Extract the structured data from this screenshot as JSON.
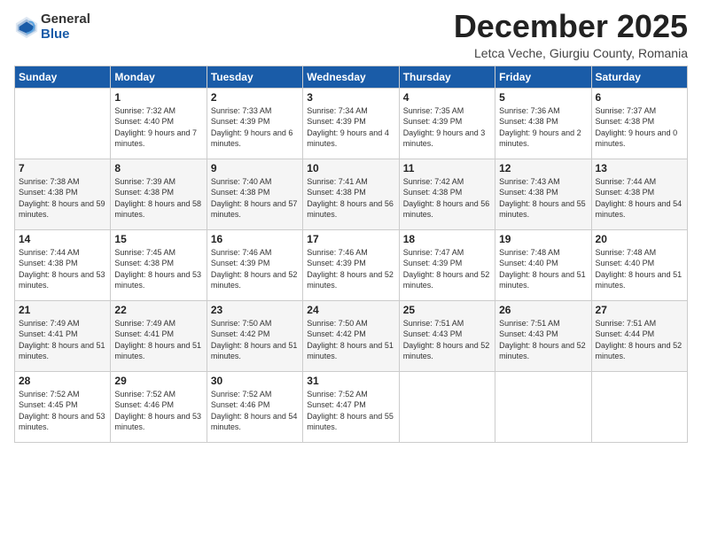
{
  "header": {
    "logo_line1": "General",
    "logo_line2": "Blue",
    "title": "December 2025",
    "location": "Letca Veche, Giurgiu County, Romania"
  },
  "days_of_week": [
    "Sunday",
    "Monday",
    "Tuesday",
    "Wednesday",
    "Thursday",
    "Friday",
    "Saturday"
  ],
  "weeks": [
    [
      {
        "day": "",
        "sunrise": "",
        "sunset": "",
        "daylight": ""
      },
      {
        "day": "1",
        "sunrise": "Sunrise: 7:32 AM",
        "sunset": "Sunset: 4:40 PM",
        "daylight": "Daylight: 9 hours and 7 minutes."
      },
      {
        "day": "2",
        "sunrise": "Sunrise: 7:33 AM",
        "sunset": "Sunset: 4:39 PM",
        "daylight": "Daylight: 9 hours and 6 minutes."
      },
      {
        "day": "3",
        "sunrise": "Sunrise: 7:34 AM",
        "sunset": "Sunset: 4:39 PM",
        "daylight": "Daylight: 9 hours and 4 minutes."
      },
      {
        "day": "4",
        "sunrise": "Sunrise: 7:35 AM",
        "sunset": "Sunset: 4:39 PM",
        "daylight": "Daylight: 9 hours and 3 minutes."
      },
      {
        "day": "5",
        "sunrise": "Sunrise: 7:36 AM",
        "sunset": "Sunset: 4:38 PM",
        "daylight": "Daylight: 9 hours and 2 minutes."
      },
      {
        "day": "6",
        "sunrise": "Sunrise: 7:37 AM",
        "sunset": "Sunset: 4:38 PM",
        "daylight": "Daylight: 9 hours and 0 minutes."
      }
    ],
    [
      {
        "day": "7",
        "sunrise": "Sunrise: 7:38 AM",
        "sunset": "Sunset: 4:38 PM",
        "daylight": "Daylight: 8 hours and 59 minutes."
      },
      {
        "day": "8",
        "sunrise": "Sunrise: 7:39 AM",
        "sunset": "Sunset: 4:38 PM",
        "daylight": "Daylight: 8 hours and 58 minutes."
      },
      {
        "day": "9",
        "sunrise": "Sunrise: 7:40 AM",
        "sunset": "Sunset: 4:38 PM",
        "daylight": "Daylight: 8 hours and 57 minutes."
      },
      {
        "day": "10",
        "sunrise": "Sunrise: 7:41 AM",
        "sunset": "Sunset: 4:38 PM",
        "daylight": "Daylight: 8 hours and 56 minutes."
      },
      {
        "day": "11",
        "sunrise": "Sunrise: 7:42 AM",
        "sunset": "Sunset: 4:38 PM",
        "daylight": "Daylight: 8 hours and 56 minutes."
      },
      {
        "day": "12",
        "sunrise": "Sunrise: 7:43 AM",
        "sunset": "Sunset: 4:38 PM",
        "daylight": "Daylight: 8 hours and 55 minutes."
      },
      {
        "day": "13",
        "sunrise": "Sunrise: 7:44 AM",
        "sunset": "Sunset: 4:38 PM",
        "daylight": "Daylight: 8 hours and 54 minutes."
      }
    ],
    [
      {
        "day": "14",
        "sunrise": "Sunrise: 7:44 AM",
        "sunset": "Sunset: 4:38 PM",
        "daylight": "Daylight: 8 hours and 53 minutes."
      },
      {
        "day": "15",
        "sunrise": "Sunrise: 7:45 AM",
        "sunset": "Sunset: 4:38 PM",
        "daylight": "Daylight: 8 hours and 53 minutes."
      },
      {
        "day": "16",
        "sunrise": "Sunrise: 7:46 AM",
        "sunset": "Sunset: 4:39 PM",
        "daylight": "Daylight: 8 hours and 52 minutes."
      },
      {
        "day": "17",
        "sunrise": "Sunrise: 7:46 AM",
        "sunset": "Sunset: 4:39 PM",
        "daylight": "Daylight: 8 hours and 52 minutes."
      },
      {
        "day": "18",
        "sunrise": "Sunrise: 7:47 AM",
        "sunset": "Sunset: 4:39 PM",
        "daylight": "Daylight: 8 hours and 52 minutes."
      },
      {
        "day": "19",
        "sunrise": "Sunrise: 7:48 AM",
        "sunset": "Sunset: 4:40 PM",
        "daylight": "Daylight: 8 hours and 51 minutes."
      },
      {
        "day": "20",
        "sunrise": "Sunrise: 7:48 AM",
        "sunset": "Sunset: 4:40 PM",
        "daylight": "Daylight: 8 hours and 51 minutes."
      }
    ],
    [
      {
        "day": "21",
        "sunrise": "Sunrise: 7:49 AM",
        "sunset": "Sunset: 4:41 PM",
        "daylight": "Daylight: 8 hours and 51 minutes."
      },
      {
        "day": "22",
        "sunrise": "Sunrise: 7:49 AM",
        "sunset": "Sunset: 4:41 PM",
        "daylight": "Daylight: 8 hours and 51 minutes."
      },
      {
        "day": "23",
        "sunrise": "Sunrise: 7:50 AM",
        "sunset": "Sunset: 4:42 PM",
        "daylight": "Daylight: 8 hours and 51 minutes."
      },
      {
        "day": "24",
        "sunrise": "Sunrise: 7:50 AM",
        "sunset": "Sunset: 4:42 PM",
        "daylight": "Daylight: 8 hours and 51 minutes."
      },
      {
        "day": "25",
        "sunrise": "Sunrise: 7:51 AM",
        "sunset": "Sunset: 4:43 PM",
        "daylight": "Daylight: 8 hours and 52 minutes."
      },
      {
        "day": "26",
        "sunrise": "Sunrise: 7:51 AM",
        "sunset": "Sunset: 4:43 PM",
        "daylight": "Daylight: 8 hours and 52 minutes."
      },
      {
        "day": "27",
        "sunrise": "Sunrise: 7:51 AM",
        "sunset": "Sunset: 4:44 PM",
        "daylight": "Daylight: 8 hours and 52 minutes."
      }
    ],
    [
      {
        "day": "28",
        "sunrise": "Sunrise: 7:52 AM",
        "sunset": "Sunset: 4:45 PM",
        "daylight": "Daylight: 8 hours and 53 minutes."
      },
      {
        "day": "29",
        "sunrise": "Sunrise: 7:52 AM",
        "sunset": "Sunset: 4:46 PM",
        "daylight": "Daylight: 8 hours and 53 minutes."
      },
      {
        "day": "30",
        "sunrise": "Sunrise: 7:52 AM",
        "sunset": "Sunset: 4:46 PM",
        "daylight": "Daylight: 8 hours and 54 minutes."
      },
      {
        "day": "31",
        "sunrise": "Sunrise: 7:52 AM",
        "sunset": "Sunset: 4:47 PM",
        "daylight": "Daylight: 8 hours and 55 minutes."
      },
      {
        "day": "",
        "sunrise": "",
        "sunset": "",
        "daylight": ""
      },
      {
        "day": "",
        "sunrise": "",
        "sunset": "",
        "daylight": ""
      },
      {
        "day": "",
        "sunrise": "",
        "sunset": "",
        "daylight": ""
      }
    ]
  ]
}
